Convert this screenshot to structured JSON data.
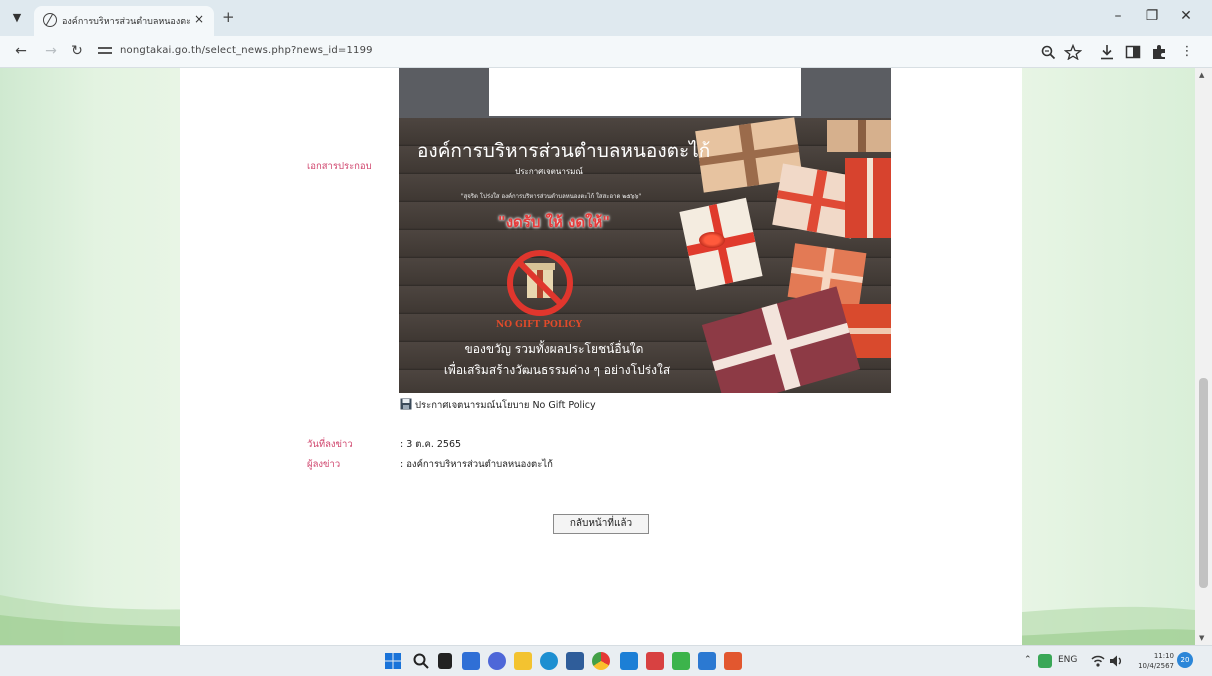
{
  "browser": {
    "tab_title": "องค์การบริหารส่วนตำบลหนองตะไก้",
    "url": "nongtakai.go.th/select_news.php?news_id=1199",
    "tab_close": "×",
    "new_tab": "+",
    "minimize": "–",
    "restore": "❐",
    "close": "✕",
    "back": "←",
    "forward": "→",
    "reload": "↻",
    "menu": "⋮"
  },
  "news": {
    "attachment_label": "เอกสารประกอบ",
    "attachment_link": "ประกาศเจตนารมณ์นโยบาย No Gift Policy",
    "date_label": "วันที่ลงข่าว",
    "date_value": ": 3 ต.ค. 2565",
    "author_label": "ผู้ลงข่าว",
    "author_value": ": องค์การบริหารส่วนตำบลหนองตะไก้",
    "back_button": "กลับหน้าที่แล้ว"
  },
  "poster": {
    "title": "องค์การบริหารส่วนตำบลหนองตะไก้",
    "subtitle": "ประกาศเจตนารมณ์",
    "quote": "\"สุจริต โปร่งใส องค์การบริหารส่วนตำบลหนองตะไก้ ใสสะอาด ๒๕๖๖\"",
    "slogan": "\"งดรับ ให้ งดให้\"",
    "policy": "NO GIFT POLICY",
    "line1": "ของขวัญ รวมทั้งผลประโยชน์อื่นใด",
    "line2": "เพื่อเสริมสร้างวัฒนธรรมค่าง ๆ อย่างโปร่งใส"
  },
  "taskbar": {
    "language": "ENG",
    "time": "11:10",
    "date": "10/4/2567",
    "notifications": "20"
  },
  "colors": {
    "label_pink": "#d0456d",
    "page_bg": "#e8f5e5"
  }
}
